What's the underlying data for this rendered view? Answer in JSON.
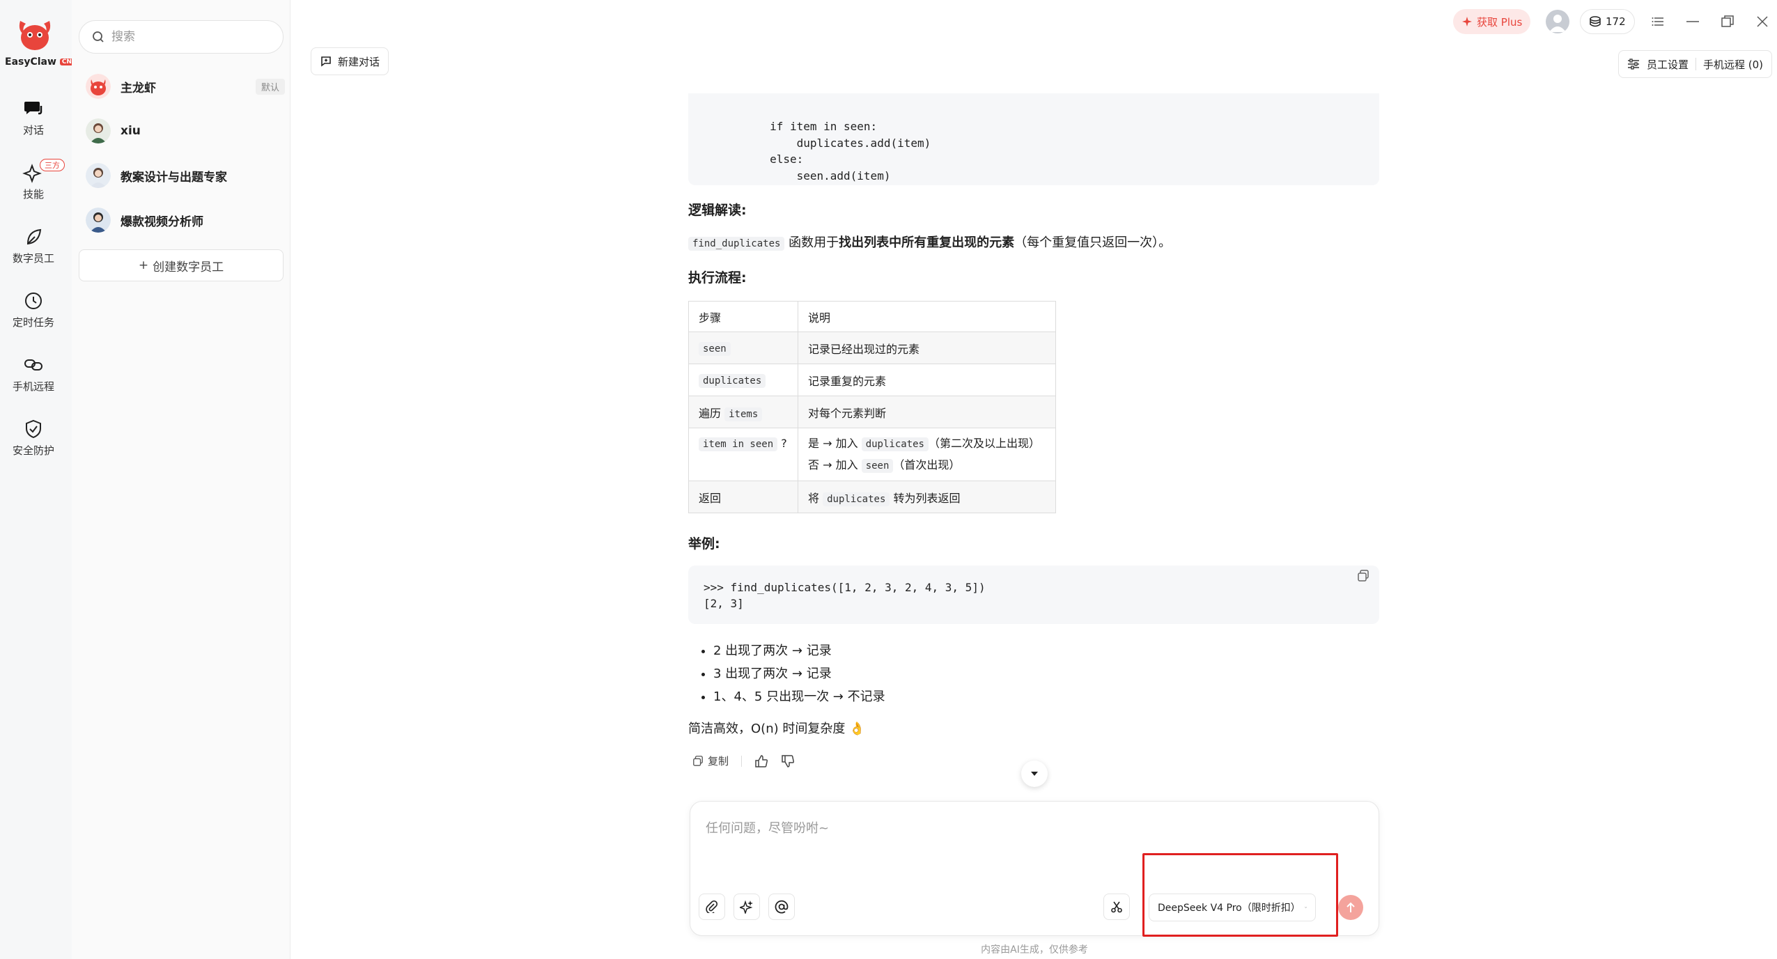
{
  "brand": {
    "name": "EasyClaw",
    "badge": "CN"
  },
  "rail": {
    "items": [
      {
        "label": "对话",
        "icon": "chat-icon"
      },
      {
        "label": "技能",
        "icon": "sparkle-icon",
        "badge": "三方"
      },
      {
        "label": "数字员工",
        "icon": "leaf-icon"
      },
      {
        "label": "定时任务",
        "icon": "clock-icon"
      },
      {
        "label": "手机远程",
        "icon": "link-icon"
      },
      {
        "label": "安全防护",
        "icon": "shield-icon"
      }
    ]
  },
  "sidebar": {
    "search_placeholder": "搜索",
    "agents": [
      {
        "name": "主龙虾",
        "tag": "默认"
      },
      {
        "name": "xiu"
      },
      {
        "name": "教案设计与出题专家"
      },
      {
        "name": "爆款视频分析师"
      }
    ],
    "create_label": "创建数字员工"
  },
  "topbar": {
    "new_chat": "新建对话",
    "get_plus": "获取 Plus",
    "credits": "172",
    "staff_settings": "员工设置",
    "phone_remote": "手机远程 (0)"
  },
  "message": {
    "code_top": "        if item in seen:\n            duplicates.add(item)\n        else:\n            seen.add(item)\n    return list(duplicates)",
    "logic_heading": "逻辑解读:",
    "logic_code": "find_duplicates",
    "logic_text_1": " 函数用于",
    "logic_bold": "找出列表中所有重复出现的元素",
    "logic_text_2": "（每个重复值只返回一次）。",
    "flow_heading": "执行流程:",
    "table": {
      "headers": [
        "步骤",
        "说明"
      ],
      "rows": [
        {
          "step_code": "seen",
          "desc": "记录已经出现过的元素"
        },
        {
          "step_code": "duplicates",
          "desc": "记录重复的元素"
        },
        {
          "step_prefix": "遍历",
          "step_code": "items",
          "desc": "对每个元素判断"
        },
        {
          "step_code": "item in seen",
          "step_suffix": "?",
          "desc_l1_a": "是 → 加入",
          "desc_l1_code": "duplicates",
          "desc_l1_b": "（第二次及以上出现）",
          "desc_l2_a": "否 → 加入",
          "desc_l2_code": "seen",
          "desc_l2_b": "（首次出现）"
        },
        {
          "step_prefix": "返回",
          "desc_a": "将",
          "desc_code": "duplicates",
          "desc_b": "转为列表返回"
        }
      ]
    },
    "example_heading": "举例:",
    "example_code": ">>> find_duplicates([1, 2, 3, 2, 4, 3, 5])\n[2, 3]",
    "bullets": [
      "2 出现了两次 → 记录",
      "3 出现了两次 → 记录",
      "1、4、5 只出现一次 → 不记录"
    ],
    "summary": "简洁高效，O(n) 时间复杂度 👌",
    "copy_label": "复制"
  },
  "composer": {
    "placeholder": "任何问题，尽管吩咐~",
    "model": "DeepSeek V4 Pro（限时折扣）"
  },
  "footnote": "内容由AI生成，仅供参考",
  "colors": {
    "accent": "#e8453c",
    "highlight": "#e02020"
  }
}
